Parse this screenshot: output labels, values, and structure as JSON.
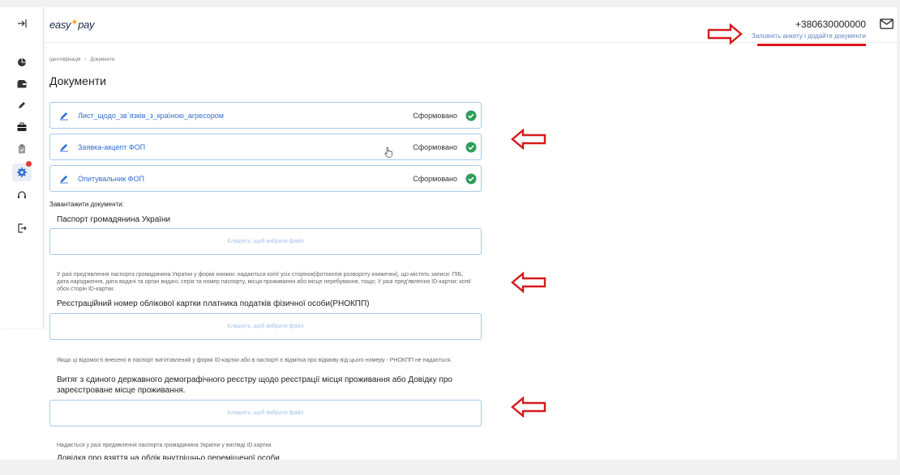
{
  "header": {
    "logo_text": "easy",
    "logo_text2": "pay",
    "phone": "+380630000000",
    "hint": "Заповніть анкету і додайте документи"
  },
  "breadcrumb": {
    "item1": "Ідентифікація",
    "item2": "Документи"
  },
  "page_title": "Документи",
  "documents": [
    {
      "name": "Лист_щодо_зв`язків_з_країною_агресором",
      "status": "Сформовано"
    },
    {
      "name": "Заявка-акцепт ФОП",
      "status": "Сформовано"
    },
    {
      "name": "Опитувальник ФОП",
      "status": "Сформовано"
    }
  ],
  "upload": {
    "label": "Завантажити документи:",
    "dropzone_text": "Клацніть, щоб вибрати файл",
    "sections": [
      {
        "title": "Паспорт громадянина України",
        "note": "У разі пред'явлення паспорта громадянина України у формі книжки: надаються копії усіх сторінок(фотокопія розвороту книжечки), що містять записи: ПІБ, дата народження, дата видачі та орган видачі, серія та номер паспорту, місця проживання або місце перебування, тощо; У разі пред'явлення ID-картки: копії обох сторін ID-картки."
      },
      {
        "title": "Реєстраційний номер облікової картки платника податків фізичної особи(РНОКПП)",
        "note": "Якщо ці відомості внесено в паспорт виготовлений у формі ID-картки або в паспорті є відмітка про відмову від цього номеру - РНОКПП не надається."
      },
      {
        "title": "Витяг з єдиного державного демографічного реєстру щодо реєстрації місця проживання або Довідку про зареєстроване місце проживання.",
        "note": "Надається у разі предявлення паспорта громадянина України у вигляді ID картки."
      },
      {
        "title": "Довідка про взяття на облік внутрішньо переміщеної особи"
      }
    ]
  },
  "colors": {
    "accent": "#2f6fd1",
    "border": "#a9c8ec",
    "success": "#2e9e5b",
    "annotation": "#e0151b"
  },
  "icons": {
    "sidebar": [
      "collapse-icon",
      "chart-icon",
      "wallet-icon",
      "pencil-icon",
      "briefcase-icon",
      "clipboard-icon",
      "gear-icon",
      "headset-icon",
      "logout-icon"
    ],
    "header": [
      "mail-icon"
    ]
  }
}
